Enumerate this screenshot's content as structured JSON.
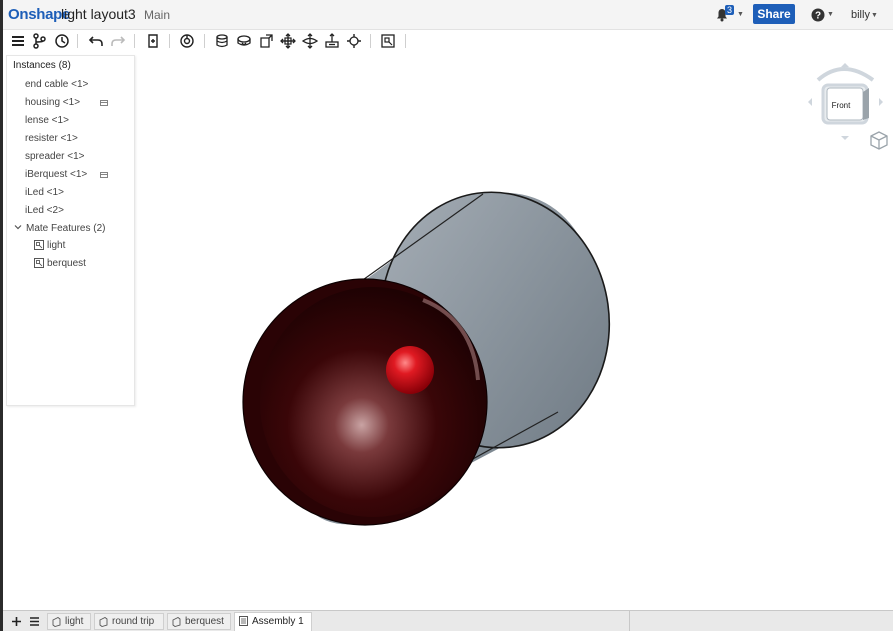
{
  "header": {
    "logo": "Onshape",
    "document_title": "light layout3",
    "branch": "Main",
    "notification_count": "3",
    "share_label": "Share",
    "user_name": "billy"
  },
  "toolbar": {
    "icons": [
      "menu-icon",
      "version-graph-icon",
      "history-icon",
      "undo-icon",
      "redo-icon",
      "insert-icon",
      "mate-connector-icon",
      "fastened-mate-icon",
      "revolute-mate-icon",
      "slider-mate-icon",
      "planar-mate-icon",
      "cylindrical-mate-icon",
      "pin-slot-mate-icon",
      "ball-mate-icon",
      "explode-icon"
    ]
  },
  "instances_panel": {
    "title": "Instances (8)",
    "items": [
      {
        "label": "end cable <1>",
        "has_icon": false
      },
      {
        "label": "housing <1>",
        "has_icon": true
      },
      {
        "label": "lense <1>",
        "has_icon": false
      },
      {
        "label": "resister <1>",
        "has_icon": false
      },
      {
        "label": "spreader <1>",
        "has_icon": false
      },
      {
        "label": "iBerquest <1>",
        "has_icon": true
      },
      {
        "label": "iLed <1>",
        "has_icon": false
      },
      {
        "label": "iLed <2>",
        "has_icon": false
      }
    ],
    "mate_features_title": "Mate Features (2)",
    "mate_features": [
      {
        "label": "light"
      },
      {
        "label": "berquest"
      }
    ]
  },
  "viewcube": {
    "face_label": "Front"
  },
  "tabs": [
    {
      "label": "light",
      "active": false
    },
    {
      "label": "round trip",
      "active": false
    },
    {
      "label": "berquest",
      "active": false
    },
    {
      "label": "Assembly 1",
      "active": true
    }
  ],
  "colors": {
    "brand": "#1d5eb8",
    "housing_body": "#8b96a0",
    "lens_face": "#3a0608",
    "led": "#d01018"
  }
}
